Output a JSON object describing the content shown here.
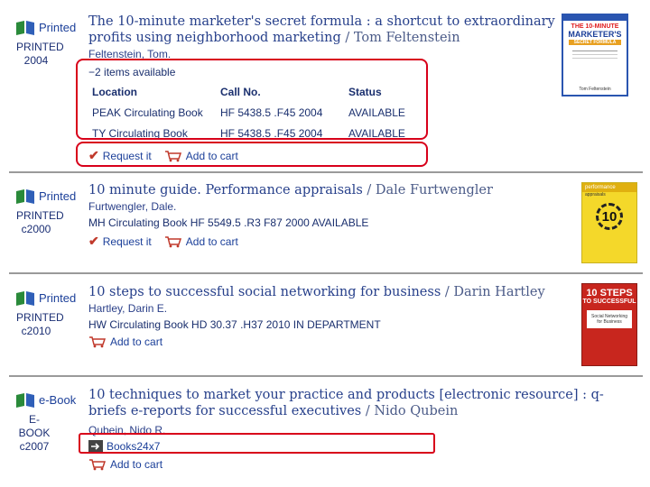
{
  "records": [
    {
      "format_label": "Printed",
      "format_type": "PRINTED",
      "format_year": "2004",
      "title": "The 10-minute marketer's secret formula : a shortcut to extraordinary profits using neighborhood marketing",
      "title_author": "/ Tom Feltenstein",
      "author": "Feltenstein, Tom.",
      "availability": "2 items available",
      "holdings_headers": {
        "location": "Location",
        "call_no": "Call No.",
        "status": "Status"
      },
      "holdings": [
        {
          "location": "PEAK Circulating Book",
          "call_no": "HF 5438.5 .F45 2004",
          "status": "AVAILABLE"
        },
        {
          "location": "TY Circulating Book",
          "call_no": "HF 5438.5 .F45 2004",
          "status": "AVAILABLE"
        }
      ],
      "actions": {
        "request": "Request it",
        "cart": "Add to cart"
      },
      "cover": {
        "line1": "THE 10-MINUTE",
        "line2": "MARKETER'S",
        "line3": "SECRET FORMULA",
        "author": "Tom Feltenstein"
      }
    },
    {
      "format_label": "Printed",
      "format_type": "PRINTED",
      "format_year": "c2000",
      "title": "10 minute guide. Performance appraisals",
      "title_author": "/ Dale Furtwengler",
      "author": "Furtwengler, Dale.",
      "holding_line": "MH Circulating Book HF 5549.5 .R3 F87 2000   AVAILABLE",
      "actions": {
        "request": "Request it",
        "cart": "Add to cart"
      },
      "cover": {
        "line1": "performance",
        "line2": "appraisals",
        "big": "10"
      }
    },
    {
      "format_label": "Printed",
      "format_type": "PRINTED",
      "format_year": "c2010",
      "title": "10 steps to successful social networking for business",
      "title_author": "/ Darin Hartley",
      "author": "Hartley, Darin E.",
      "holding_line": "HW Circulating Book HD 30.37 .H37 2010   IN DEPARTMENT",
      "actions": {
        "cart": "Add to cart"
      },
      "cover": {
        "line1": "10 STEPS",
        "line2": "TO SUCCESSFUL",
        "line3": "Social Networking for Business"
      }
    },
    {
      "format_label": "e-Book",
      "format_type": "E-BOOK",
      "format_year": "c2007",
      "title": "10 techniques to market your practice and products [electronic resource] : q-briefs e-reports for successful executives",
      "title_author": "/ Nido Qubein",
      "author": "Qubein, Nido R.",
      "link": "Books24x7",
      "actions": {
        "cart": "Add to cart"
      }
    }
  ],
  "colors": {
    "highlight": "#d8001a",
    "link": "#1b3f99",
    "check": "#c0392b"
  },
  "icons": {
    "format": "book-icon",
    "cart": "cart-icon",
    "check": "check-icon",
    "link": "arrow-link-icon"
  }
}
